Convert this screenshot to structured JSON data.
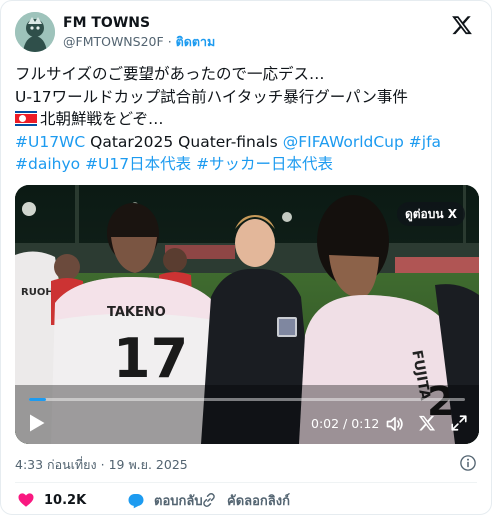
{
  "author": {
    "name": "FM TOWNS",
    "handle": "@FMTOWNS20F",
    "separator": "·",
    "follow_label": "ติดตาม"
  },
  "tweet": {
    "lines": [
      "フルサイズのご要望があったので一応デス…",
      "U-17ワールドカップ試合前ハイタッチ暴行グーパン事件",
      "北朝鮮戦をどぞ…"
    ],
    "tags_line1": [
      "#U17WC",
      "Qatar2025 Quater-finals",
      "@FIFAWorldCup",
      "#jfa"
    ],
    "tags_line2": [
      "#daihyo",
      "#U17日本代表",
      "#サッカー日本代表"
    ]
  },
  "media": {
    "watch_label": "ดูต่อบน X",
    "time": "0:02 / 0:12",
    "progress": 0.04,
    "jersey_left": "TAKENO",
    "jersey_left_number": "17",
    "jersey_right": "FUJITA",
    "jersey_far_left": "RUOH"
  },
  "meta": {
    "time": "4:33 ก่อนเที่ยง",
    "separator": "·",
    "date": "19 พ.ย. 2025"
  },
  "actions": {
    "likes": "10.2K",
    "reply_label": "ตอบกลับ",
    "copy_link_label": "คัดลอกลิงก์"
  },
  "colors": {
    "accent": "#1d9bf0",
    "like": "#f91880",
    "text": "#0f1419",
    "muted": "#536471"
  }
}
